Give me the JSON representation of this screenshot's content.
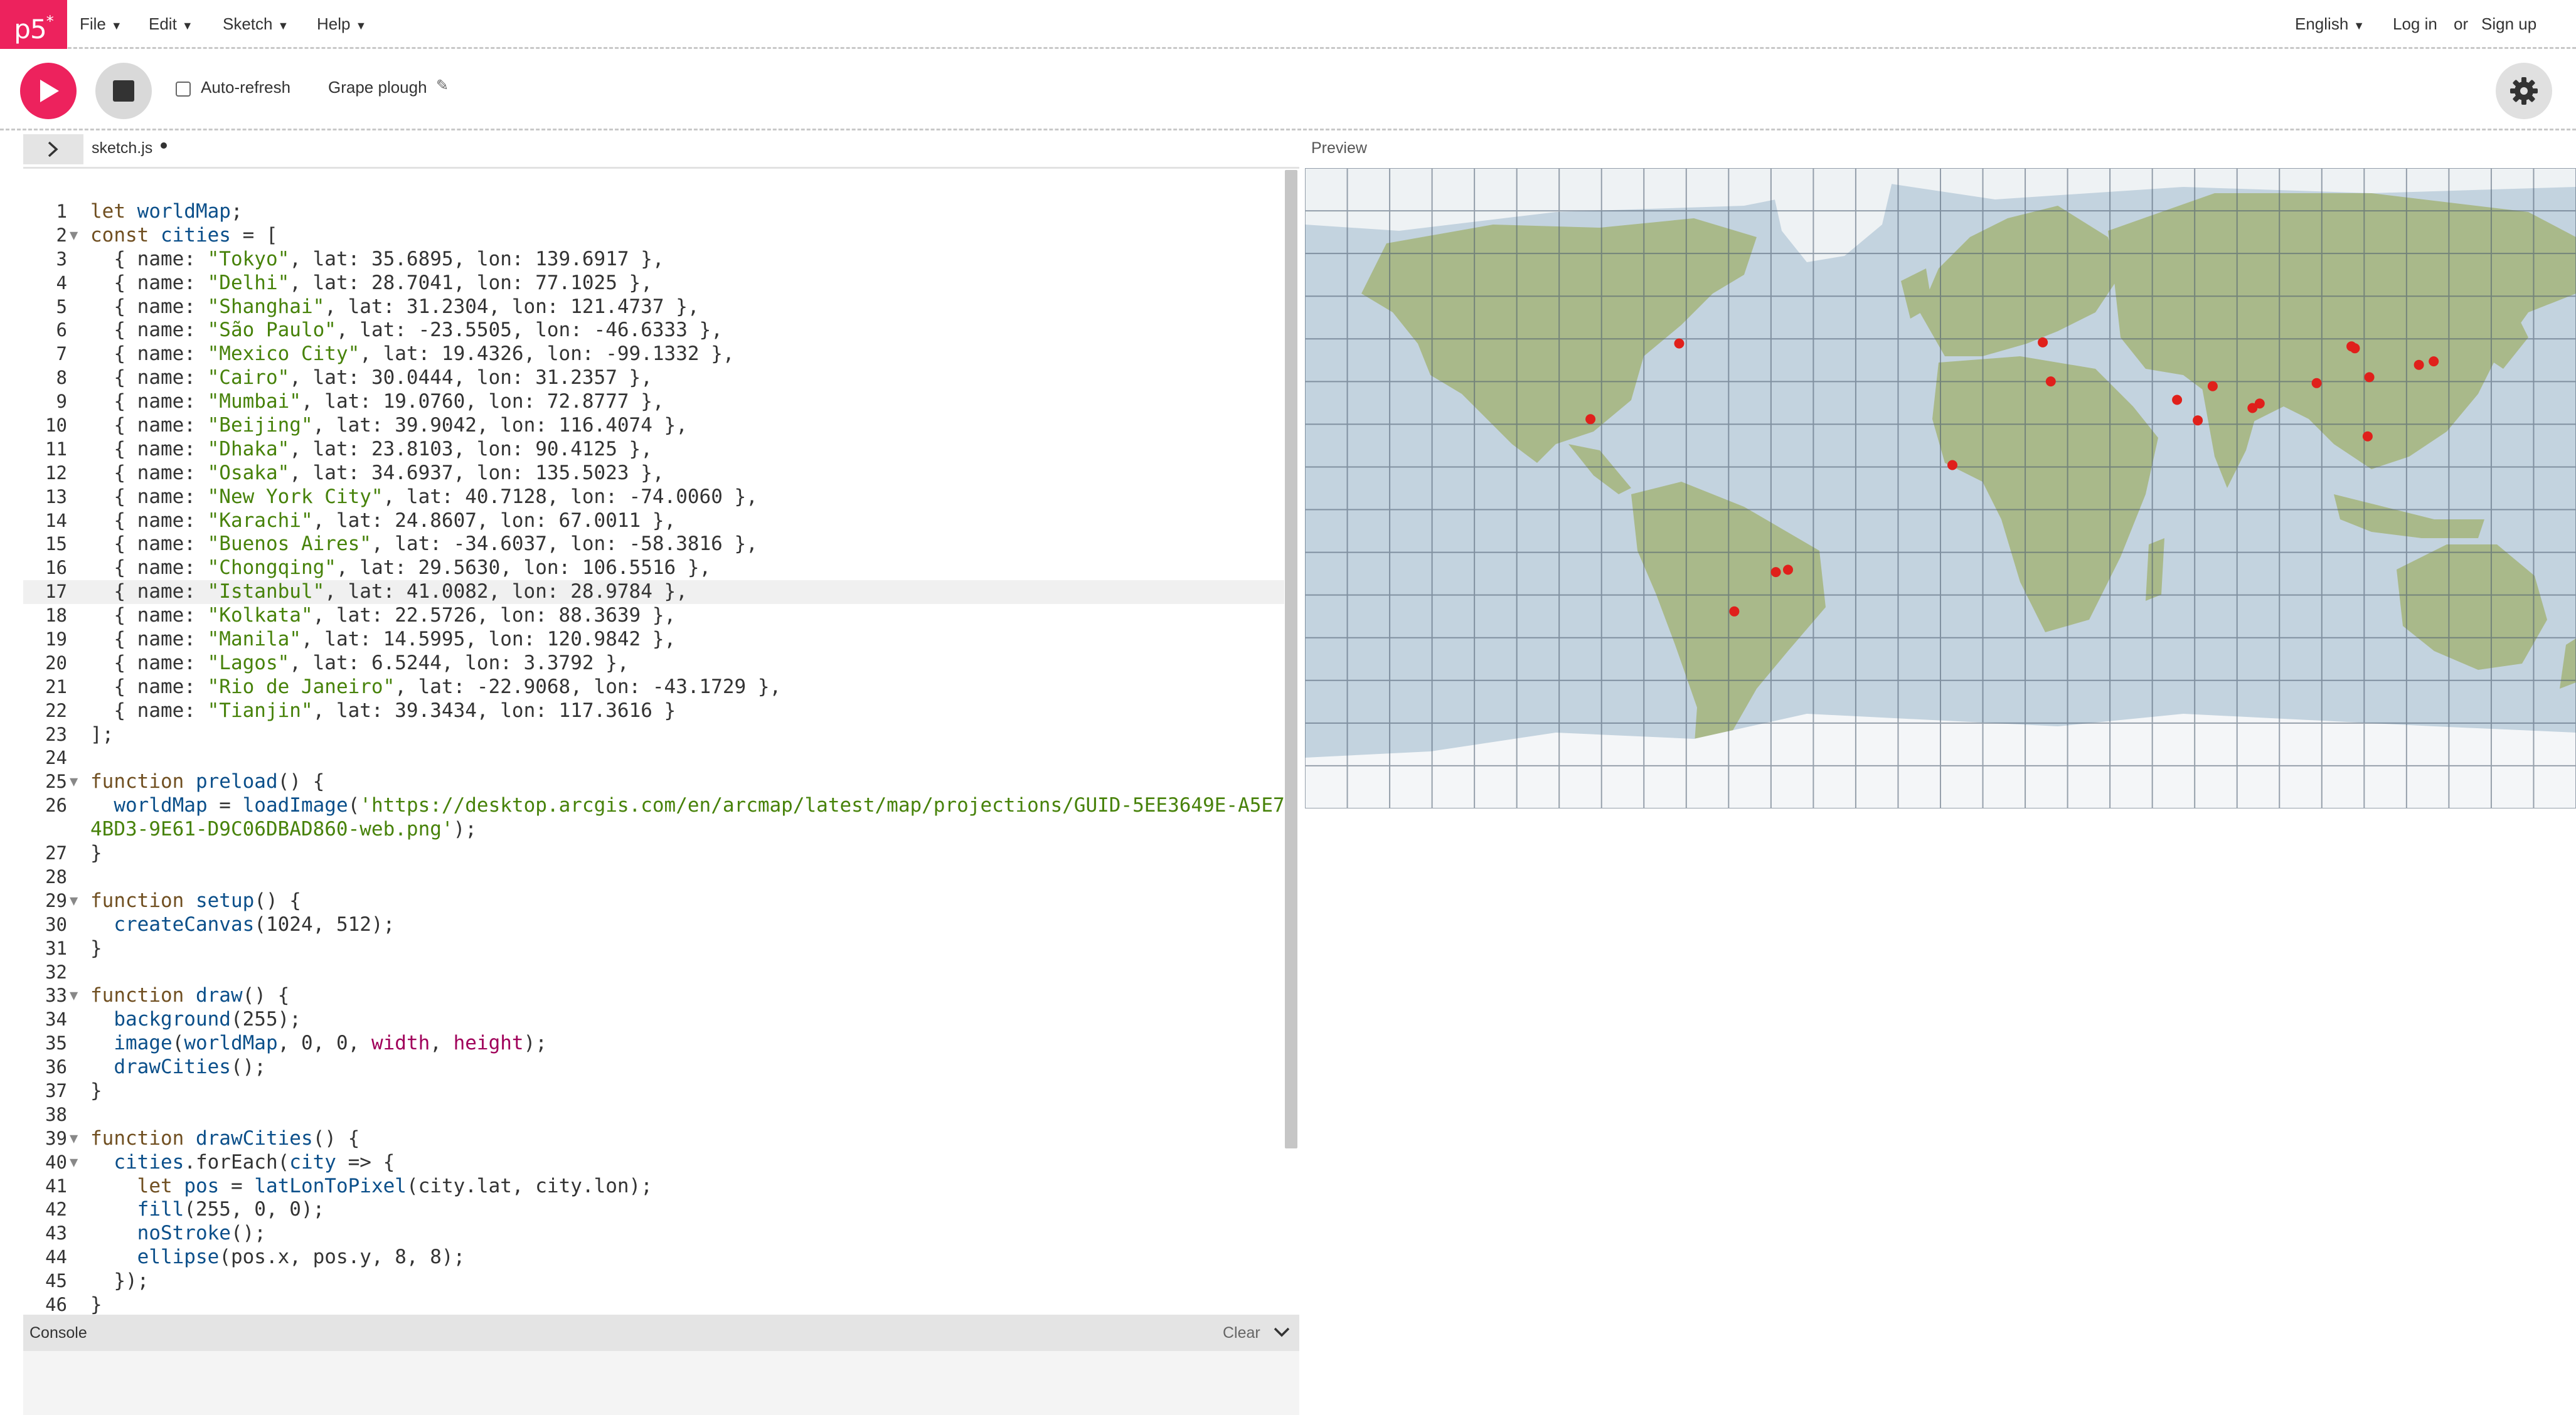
{
  "nav": {
    "logo": "p5",
    "logo_mark": "*",
    "menus": [
      "File",
      "Edit",
      "Sketch",
      "Help"
    ],
    "language": "English",
    "login": "Log in",
    "or": "or",
    "signup": "Sign up"
  },
  "toolbar": {
    "autorefresh_label": "Auto-refresh",
    "autorefresh_checked": false,
    "sketch_name": "Grape plough"
  },
  "editor": {
    "file_tab": "sketch.js",
    "unsaved": true,
    "active_line": 17,
    "fold_lines": [
      2,
      25,
      29,
      33,
      39,
      40
    ],
    "lines": [
      {
        "n": "1",
        "parts": [
          [
            "k",
            "let "
          ],
          [
            "n",
            "worldMap"
          ],
          [
            "",
            "; "
          ]
        ]
      },
      {
        "n": "2",
        "parts": [
          [
            "k",
            "const "
          ],
          [
            "n",
            "cities"
          ],
          [
            "",
            " = ["
          ]
        ]
      },
      {
        "n": "3",
        "parts": [
          [
            "",
            "  { name: "
          ],
          [
            "s",
            "\"Tokyo\""
          ],
          [
            "",
            ", lat: 35.6895, lon: 139.6917 },"
          ]
        ]
      },
      {
        "n": "4",
        "parts": [
          [
            "",
            "  { name: "
          ],
          [
            "s",
            "\"Delhi\""
          ],
          [
            "",
            ", lat: 28.7041, lon: 77.1025 },"
          ]
        ]
      },
      {
        "n": "5",
        "parts": [
          [
            "",
            "  { name: "
          ],
          [
            "s",
            "\"Shanghai\""
          ],
          [
            "",
            ", lat: 31.2304, lon: 121.4737 },"
          ]
        ]
      },
      {
        "n": "6",
        "parts": [
          [
            "",
            "  { name: "
          ],
          [
            "s",
            "\"São Paulo\""
          ],
          [
            "",
            ", lat: -23.5505, lon: -46.6333 },"
          ]
        ]
      },
      {
        "n": "7",
        "parts": [
          [
            "",
            "  { name: "
          ],
          [
            "s",
            "\"Mexico City\""
          ],
          [
            "",
            ", lat: 19.4326, lon: -99.1332 },"
          ]
        ]
      },
      {
        "n": "8",
        "parts": [
          [
            "",
            "  { name: "
          ],
          [
            "s",
            "\"Cairo\""
          ],
          [
            "",
            ", lat: 30.0444, lon: 31.2357 },"
          ]
        ]
      },
      {
        "n": "9",
        "parts": [
          [
            "",
            "  { name: "
          ],
          [
            "s",
            "\"Mumbai\""
          ],
          [
            "",
            ", lat: 19.0760, lon: 72.8777 },"
          ]
        ]
      },
      {
        "n": "10",
        "parts": [
          [
            "",
            "  { name: "
          ],
          [
            "s",
            "\"Beijing\""
          ],
          [
            "",
            ", lat: 39.9042, lon: 116.4074 },"
          ]
        ]
      },
      {
        "n": "11",
        "parts": [
          [
            "",
            "  { name: "
          ],
          [
            "s",
            "\"Dhaka\""
          ],
          [
            "",
            ", lat: 23.8103, lon: 90.4125 },"
          ]
        ]
      },
      {
        "n": "12",
        "parts": [
          [
            "",
            "  { name: "
          ],
          [
            "s",
            "\"Osaka\""
          ],
          [
            "",
            ", lat: 34.6937, lon: 135.5023 },"
          ]
        ]
      },
      {
        "n": "13",
        "parts": [
          [
            "",
            "  { name: "
          ],
          [
            "s",
            "\"New York City\""
          ],
          [
            "",
            ", lat: 40.7128, lon: -74.0060 },"
          ]
        ]
      },
      {
        "n": "14",
        "parts": [
          [
            "",
            "  { name: "
          ],
          [
            "s",
            "\"Karachi\""
          ],
          [
            "",
            ", lat: 24.8607, lon: 67.0011 },"
          ]
        ]
      },
      {
        "n": "15",
        "parts": [
          [
            "",
            "  { name: "
          ],
          [
            "s",
            "\"Buenos Aires\""
          ],
          [
            "",
            ", lat: -34.6037, lon: -58.3816 },"
          ]
        ]
      },
      {
        "n": "16",
        "parts": [
          [
            "",
            "  { name: "
          ],
          [
            "s",
            "\"Chongqing\""
          ],
          [
            "",
            ", lat: 29.5630, lon: 106.5516 },"
          ]
        ]
      },
      {
        "n": "17",
        "parts": [
          [
            "",
            "  { name: "
          ],
          [
            "s",
            "\"Istanbul\""
          ],
          [
            "",
            ", lat: 41.0082, lon: 28.9784 },"
          ]
        ]
      },
      {
        "n": "18",
        "parts": [
          [
            "",
            "  { name: "
          ],
          [
            "s",
            "\"Kolkata\""
          ],
          [
            "",
            ", lat: 22.5726, lon: 88.3639 },"
          ]
        ]
      },
      {
        "n": "19",
        "parts": [
          [
            "",
            "  { name: "
          ],
          [
            "s",
            "\"Manila\""
          ],
          [
            "",
            ", lat: 14.5995, lon: 120.9842 },"
          ]
        ]
      },
      {
        "n": "20",
        "parts": [
          [
            "",
            "  { name: "
          ],
          [
            "s",
            "\"Lagos\""
          ],
          [
            "",
            ", lat: 6.5244, lon: 3.3792 },"
          ]
        ]
      },
      {
        "n": "21",
        "parts": [
          [
            "",
            "  { name: "
          ],
          [
            "s",
            "\"Rio de Janeiro\""
          ],
          [
            "",
            ", lat: -22.9068, lon: -43.1729 },"
          ]
        ]
      },
      {
        "n": "22",
        "parts": [
          [
            "",
            "  { name: "
          ],
          [
            "s",
            "\"Tianjin\""
          ],
          [
            "",
            ", lat: 39.3434, lon: 117.3616 }"
          ]
        ]
      },
      {
        "n": "23",
        "parts": [
          [
            "",
            "];"
          ]
        ]
      },
      {
        "n": "24",
        "parts": []
      },
      {
        "n": "25",
        "parts": [
          [
            "k",
            "function "
          ],
          [
            "n",
            "preload"
          ],
          [
            "",
            "() {"
          ]
        ]
      },
      {
        "n": "26",
        "parts": [
          [
            "",
            "  "
          ],
          [
            "n",
            "worldMap"
          ],
          [
            "",
            " = "
          ],
          [
            "n",
            "loadImage"
          ],
          [
            "",
            "("
          ],
          [
            "s",
            "'https://desktop.arcgis.com/en/arcmap/latest/map/projections/GUID-5EE3649E-A5E7-"
          ]
        ]
      },
      {
        "n": "",
        "parts": [
          [
            "s",
            "4BD3-9E61-D9C06DBAD860-web.png'"
          ],
          [
            "",
            ");"
          ]
        ]
      },
      {
        "n": "27",
        "parts": [
          [
            "",
            "}"
          ]
        ]
      },
      {
        "n": "28",
        "parts": []
      },
      {
        "n": "29",
        "parts": [
          [
            "k",
            "function "
          ],
          [
            "n",
            "setup"
          ],
          [
            "",
            "() {"
          ]
        ]
      },
      {
        "n": "30",
        "parts": [
          [
            "",
            "  "
          ],
          [
            "n",
            "createCanvas"
          ],
          [
            "",
            "(1024, 512);"
          ]
        ]
      },
      {
        "n": "31",
        "parts": [
          [
            "",
            "}"
          ]
        ]
      },
      {
        "n": "32",
        "parts": []
      },
      {
        "n": "33",
        "parts": [
          [
            "k",
            "function "
          ],
          [
            "n",
            "draw"
          ],
          [
            "",
            "() {"
          ]
        ]
      },
      {
        "n": "34",
        "parts": [
          [
            "",
            "  "
          ],
          [
            "n",
            "background"
          ],
          [
            "",
            "(255);"
          ]
        ]
      },
      {
        "n": "35",
        "parts": [
          [
            "",
            "  "
          ],
          [
            "n",
            "image"
          ],
          [
            "",
            "("
          ],
          [
            "n",
            "worldMap"
          ],
          [
            "",
            ", 0, 0, "
          ],
          [
            "p",
            "width"
          ],
          [
            "",
            ", "
          ],
          [
            "p",
            "height"
          ],
          [
            "",
            ");"
          ]
        ]
      },
      {
        "n": "36",
        "parts": [
          [
            "",
            "  "
          ],
          [
            "n",
            "drawCities"
          ],
          [
            "",
            "();"
          ]
        ]
      },
      {
        "n": "37",
        "parts": [
          [
            "",
            "}"
          ]
        ]
      },
      {
        "n": "38",
        "parts": []
      },
      {
        "n": "39",
        "parts": [
          [
            "k",
            "function "
          ],
          [
            "n",
            "drawCities"
          ],
          [
            "",
            "() {"
          ]
        ]
      },
      {
        "n": "40",
        "parts": [
          [
            "",
            "  "
          ],
          [
            "n",
            "cities"
          ],
          [
            "",
            ".forEach("
          ],
          [
            "n",
            "city"
          ],
          [
            "",
            " => {"
          ]
        ]
      },
      {
        "n": "41",
        "parts": [
          [
            "",
            "    "
          ],
          [
            "k",
            "let "
          ],
          [
            "n",
            "pos"
          ],
          [
            "",
            " = "
          ],
          [
            "n",
            "latLonToPixel"
          ],
          [
            "",
            "(city.lat, city.lon);"
          ]
        ]
      },
      {
        "n": "42",
        "parts": [
          [
            "",
            "    "
          ],
          [
            "n",
            "fill"
          ],
          [
            "",
            "(255, 0, 0);"
          ]
        ]
      },
      {
        "n": "43",
        "parts": [
          [
            "",
            "    "
          ],
          [
            "n",
            "noStroke"
          ],
          [
            "",
            "();"
          ]
        ]
      },
      {
        "n": "44",
        "parts": [
          [
            "",
            "    "
          ],
          [
            "n",
            "ellipse"
          ],
          [
            "",
            "(pos.x, pos.y, 8, 8);"
          ]
        ]
      },
      {
        "n": "45",
        "parts": [
          [
            "",
            "  });"
          ]
        ]
      },
      {
        "n": "46",
        "parts": [
          [
            "",
            "}"
          ]
        ]
      }
    ]
  },
  "console": {
    "title": "Console",
    "clear": "Clear"
  },
  "preview": {
    "label": "Preview",
    "cities": [
      {
        "lat": 35.6895,
        "lon": 139.6917
      },
      {
        "lat": 28.7041,
        "lon": 77.1025
      },
      {
        "lat": 31.2304,
        "lon": 121.4737
      },
      {
        "lat": -23.5505,
        "lon": -46.6333
      },
      {
        "lat": 19.4326,
        "lon": -99.1332
      },
      {
        "lat": 30.0444,
        "lon": 31.2357
      },
      {
        "lat": 19.076,
        "lon": 72.8777
      },
      {
        "lat": 39.9042,
        "lon": 116.4074
      },
      {
        "lat": 23.8103,
        "lon": 90.4125
      },
      {
        "lat": 34.6937,
        "lon": 135.5023
      },
      {
        "lat": 40.7128,
        "lon": -74.006
      },
      {
        "lat": 24.8607,
        "lon": 67.0011
      },
      {
        "lat": -34.6037,
        "lon": -58.3816
      },
      {
        "lat": 29.563,
        "lon": 106.5516
      },
      {
        "lat": 41.0082,
        "lon": 28.9784
      },
      {
        "lat": 22.5726,
        "lon": 88.3639
      },
      {
        "lat": 14.5995,
        "lon": 120.9842
      },
      {
        "lat": 6.5244,
        "lon": 3.3792
      },
      {
        "lat": -22.9068,
        "lon": -43.1729
      },
      {
        "lat": 39.3434,
        "lon": 117.3616
      }
    ]
  },
  "colors": {
    "brand": "#ed225d",
    "city_dot": "#e0201b",
    "ocean": "#c3d3df",
    "land": "#a9b98a",
    "ice": "#f4f6f8",
    "grid": "#4a5a6e"
  }
}
